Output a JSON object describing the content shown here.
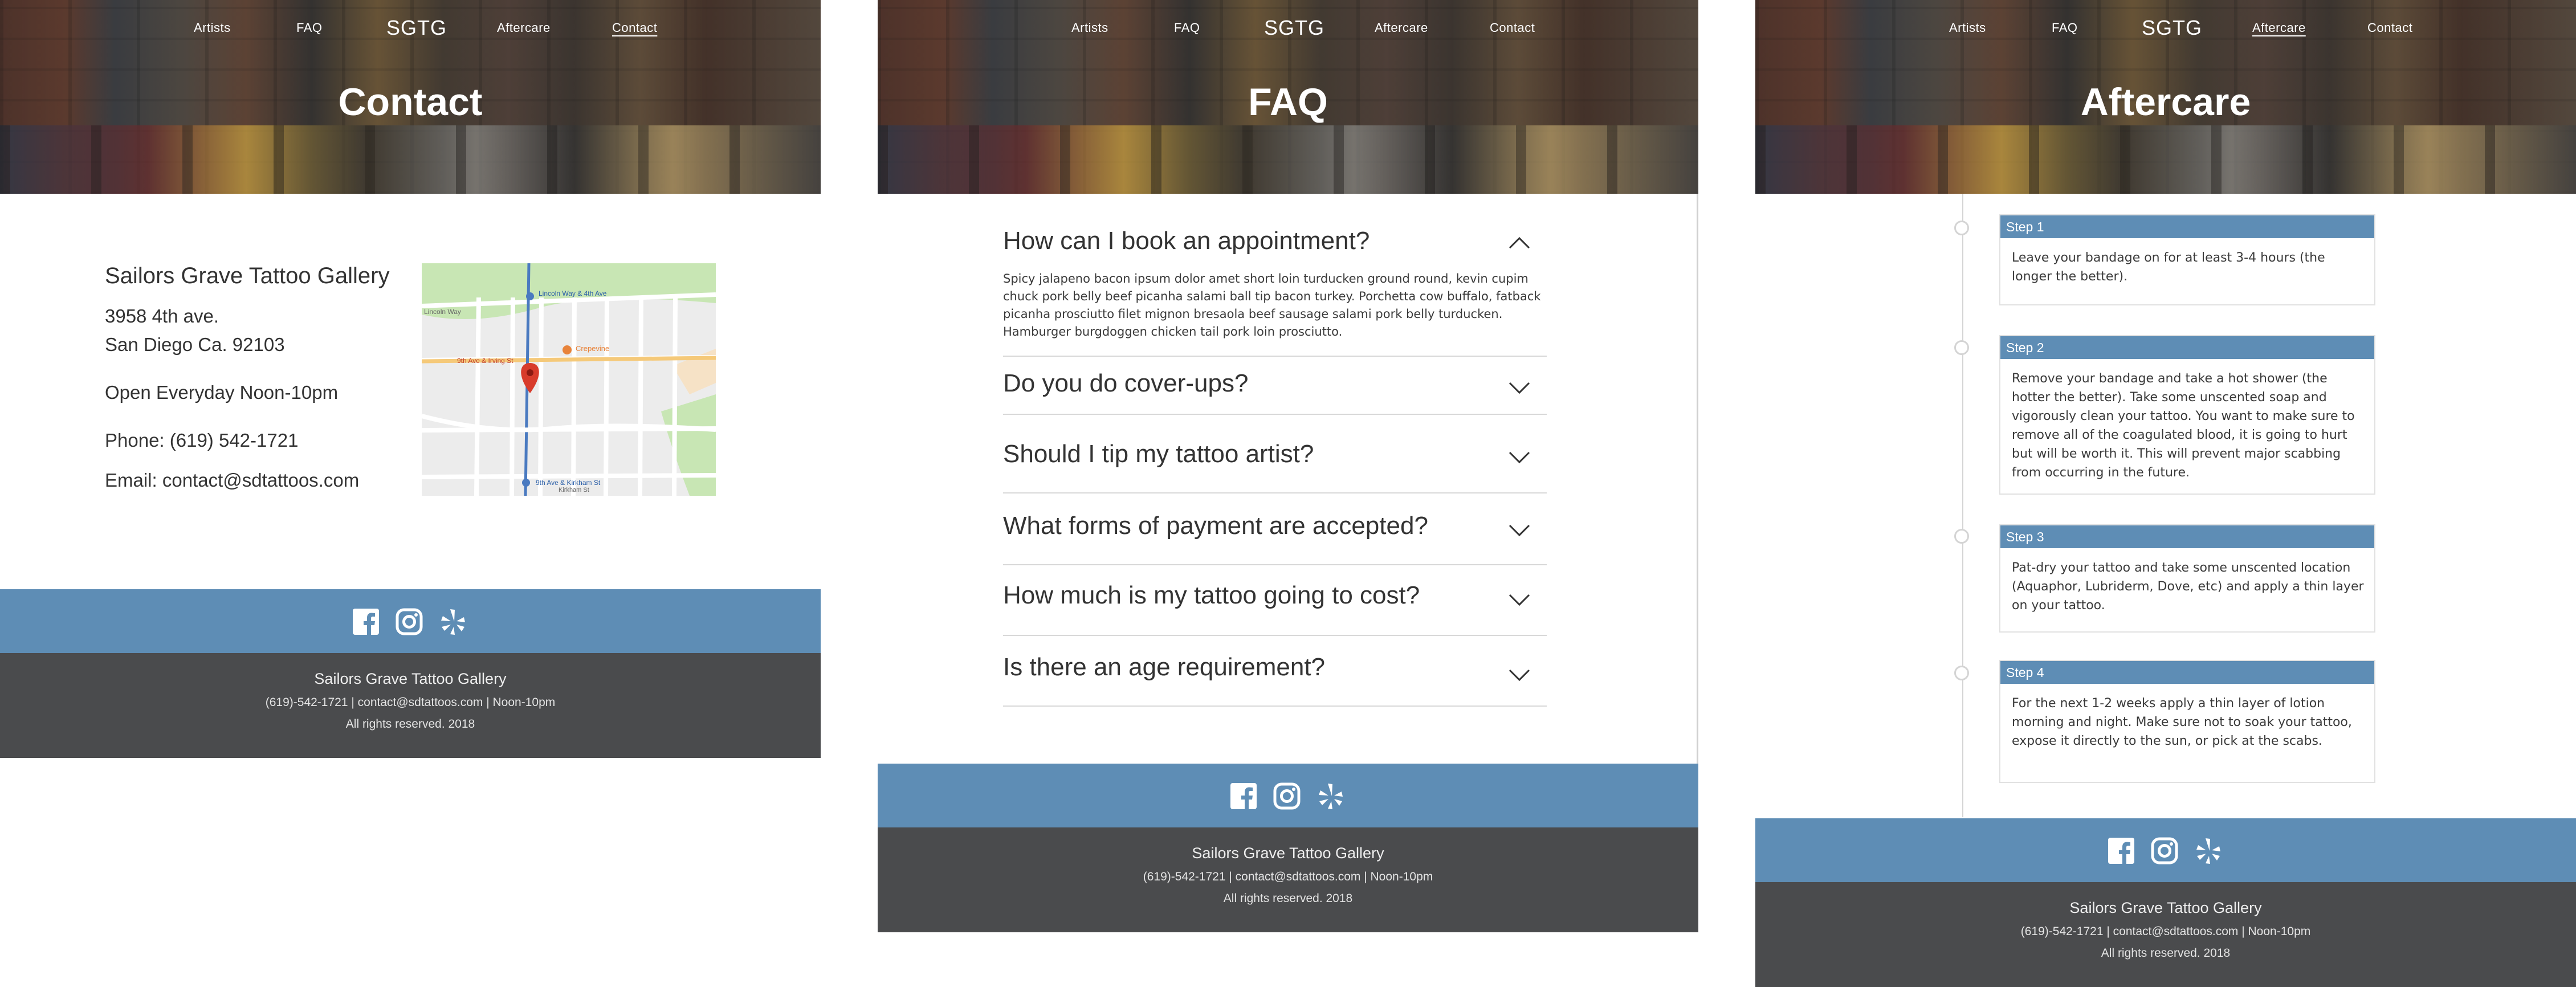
{
  "nav": {
    "artists": "Artists",
    "faq": "FAQ",
    "logo": "SGTG",
    "aftercare": "Aftercare",
    "contact": "Contact"
  },
  "footer": {
    "name": "Sailors Grave Tattoo Gallery",
    "line1": "(619)-542-1721 | contact@sdtattoos.com | Noon-10pm",
    "line2": "All rights reserved. 2018",
    "icons": [
      "facebook-icon",
      "instagram-icon",
      "yelp-icon"
    ]
  },
  "contact_page": {
    "title": "Contact",
    "business": "Sailors Grave Tattoo Gallery",
    "address1": "3958 4th ave.",
    "address2": "San Diego Ca. 92103",
    "hours": "Open Everyday Noon-10pm",
    "phone": "Phone: (619) 542-1721",
    "email": "Email: contact@sdtattoos.com",
    "map": {
      "labels": [
        "Lincoln Way & 4th Ave",
        "Lincoln Way",
        "9th Ave & Irving St",
        "Crepevine",
        "9th Ave & Kirkham St",
        "Kirkham St"
      ]
    }
  },
  "faq_page": {
    "title": "FAQ",
    "items": [
      {
        "q": "How can I book an appointment?",
        "open": true
      },
      {
        "q": "Do you do cover-ups?",
        "open": false
      },
      {
        "q": "Should I tip my tattoo artist?",
        "open": false
      },
      {
        "q": "What forms of payment are accepted?",
        "open": false
      },
      {
        "q": "How much is my tattoo going to cost?",
        "open": false
      },
      {
        "q": "Is there an age requirement?",
        "open": false
      }
    ],
    "answer": "Spicy jalapeno bacon ipsum dolor amet short loin turducken ground round, kevin cupim chuck pork belly beef picanha salami ball tip bacon turkey. Porchetta cow buffalo, fatback picanha prosciutto filet mignon bresaola beef sausage salami pork belly turducken. Hamburger burgdoggen chicken tail pork loin prosciutto."
  },
  "aftercare_page": {
    "title": "Aftercare",
    "steps": [
      {
        "label": "Step 1",
        "text": "Leave your bandage on for at least 3-4 hours (the longer the better)."
      },
      {
        "label": "Step 2",
        "text": "Remove your bandage and take a hot shower (the hotter the better). Take some unscented soap and vigorously clean your tattoo. You want to make sure to remove all of the coagulated blood, it is going to hurt but will be worth it. This will prevent major scabbing from occurring in the future."
      },
      {
        "label": "Step 3",
        "text": "Pat-dry your tattoo and take some unscented location (Aquaphor, Lubriderm, Dove, etc) and apply a thin layer on your tattoo."
      },
      {
        "label": "Step 4",
        "text": "For the next 1-2 weeks apply a thin layer of lotion morning and night. Make sure not to soak your tattoo, expose it directly to the sun, or pick at the scabs."
      }
    ]
  },
  "colors": {
    "footer_blue": "#5e8db5",
    "footer_dark": "#4a4b4d",
    "step_header": "#5e8db5"
  }
}
